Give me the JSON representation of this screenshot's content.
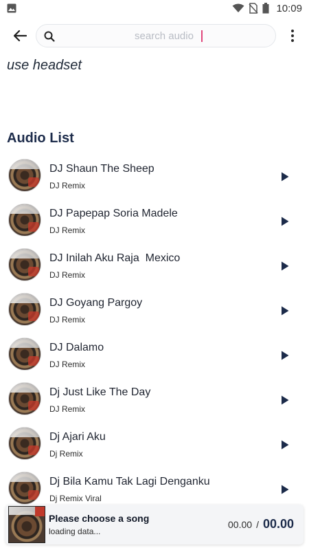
{
  "status_bar": {
    "time": "10:09",
    "icons": [
      "image-icon",
      "wifi-icon",
      "no-sim-icon",
      "battery-icon"
    ]
  },
  "toolbar": {
    "back_icon": "arrow-left-icon",
    "search_placeholder": "search audio",
    "search_value": "",
    "search_icon": "search-icon",
    "menu_icon": "more-vertical-icon"
  },
  "hint": "use headset",
  "section_title": "Audio List",
  "audio_list": [
    {
      "title": "DJ Shaun The Sheep",
      "artist": "DJ Remix"
    },
    {
      "title": "DJ Papepap Soria Madele",
      "artist": "DJ Remix"
    },
    {
      "title": "DJ Inilah Aku Raja  Mexico",
      "artist": "DJ Remix"
    },
    {
      "title": "DJ Goyang Pargoy",
      "artist": "DJ Remix"
    },
    {
      "title": "DJ Dalamo",
      "artist": "DJ Remix"
    },
    {
      "title": "Dj Just Like The Day",
      "artist": "DJ Remix"
    },
    {
      "title": "Dj Ajari Aku",
      "artist": "Dj Remix"
    },
    {
      "title": "Dj Bila Kamu Tak Lagi Denganku",
      "artist": "Dj Remix Viral"
    }
  ],
  "player": {
    "title": "Please choose a song",
    "status": "loading data...",
    "current_time": "00.00",
    "separator": "/",
    "total_time": "00.00"
  },
  "colors": {
    "accent": "#1c2b4a",
    "caret": "#e0457b",
    "player_bg": "#f4f5f7"
  }
}
